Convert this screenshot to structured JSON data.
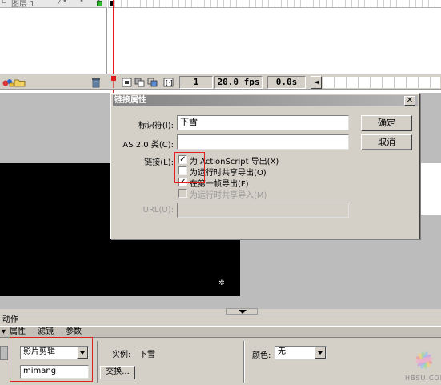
{
  "timeline": {
    "layer_name": "图层 1",
    "layer_dots": "• • •",
    "current_frame": "1",
    "frame_rate": "20.0 fps",
    "elapsed_time": "0.0s"
  },
  "dialog": {
    "title": "链接属性",
    "close_glyph": "✕",
    "identifier_label": "标识符(I):",
    "identifier_value": "下雪",
    "as2_class_label": "AS 2.0 类(C):",
    "as2_class_value": "",
    "linkage_label": "链接(L):",
    "options": [
      {
        "label": "为 ActionScript 导出(X)",
        "checked": true,
        "disabled": false
      },
      {
        "label": "为运行时共享导出(O)",
        "checked": false,
        "disabled": false
      },
      {
        "label": "在第一帧导出(F)",
        "checked": true,
        "disabled": false
      },
      {
        "label": "为运行时共享导入(M)",
        "checked": false,
        "disabled": true
      }
    ],
    "url_label": "URL(U):",
    "url_value": "",
    "ok_label": "确定",
    "cancel_label": "取消"
  },
  "panel": {
    "actions_label": "动作",
    "tabs": [
      "属性",
      "滤镜",
      "参数"
    ],
    "symbol_type": "影片剪辑",
    "instance_name": "mimang",
    "instance_label": "实例:",
    "instance_value": "下雪",
    "swap_label": "交换...",
    "color_label": "颜色:",
    "color_value": "无"
  },
  "watermark": {
    "text": "HBSU.COM"
  },
  "colors": {
    "accent_red": "#e02020",
    "playhead": "#e21b1b",
    "keyframe_green": "#2fb92f"
  }
}
